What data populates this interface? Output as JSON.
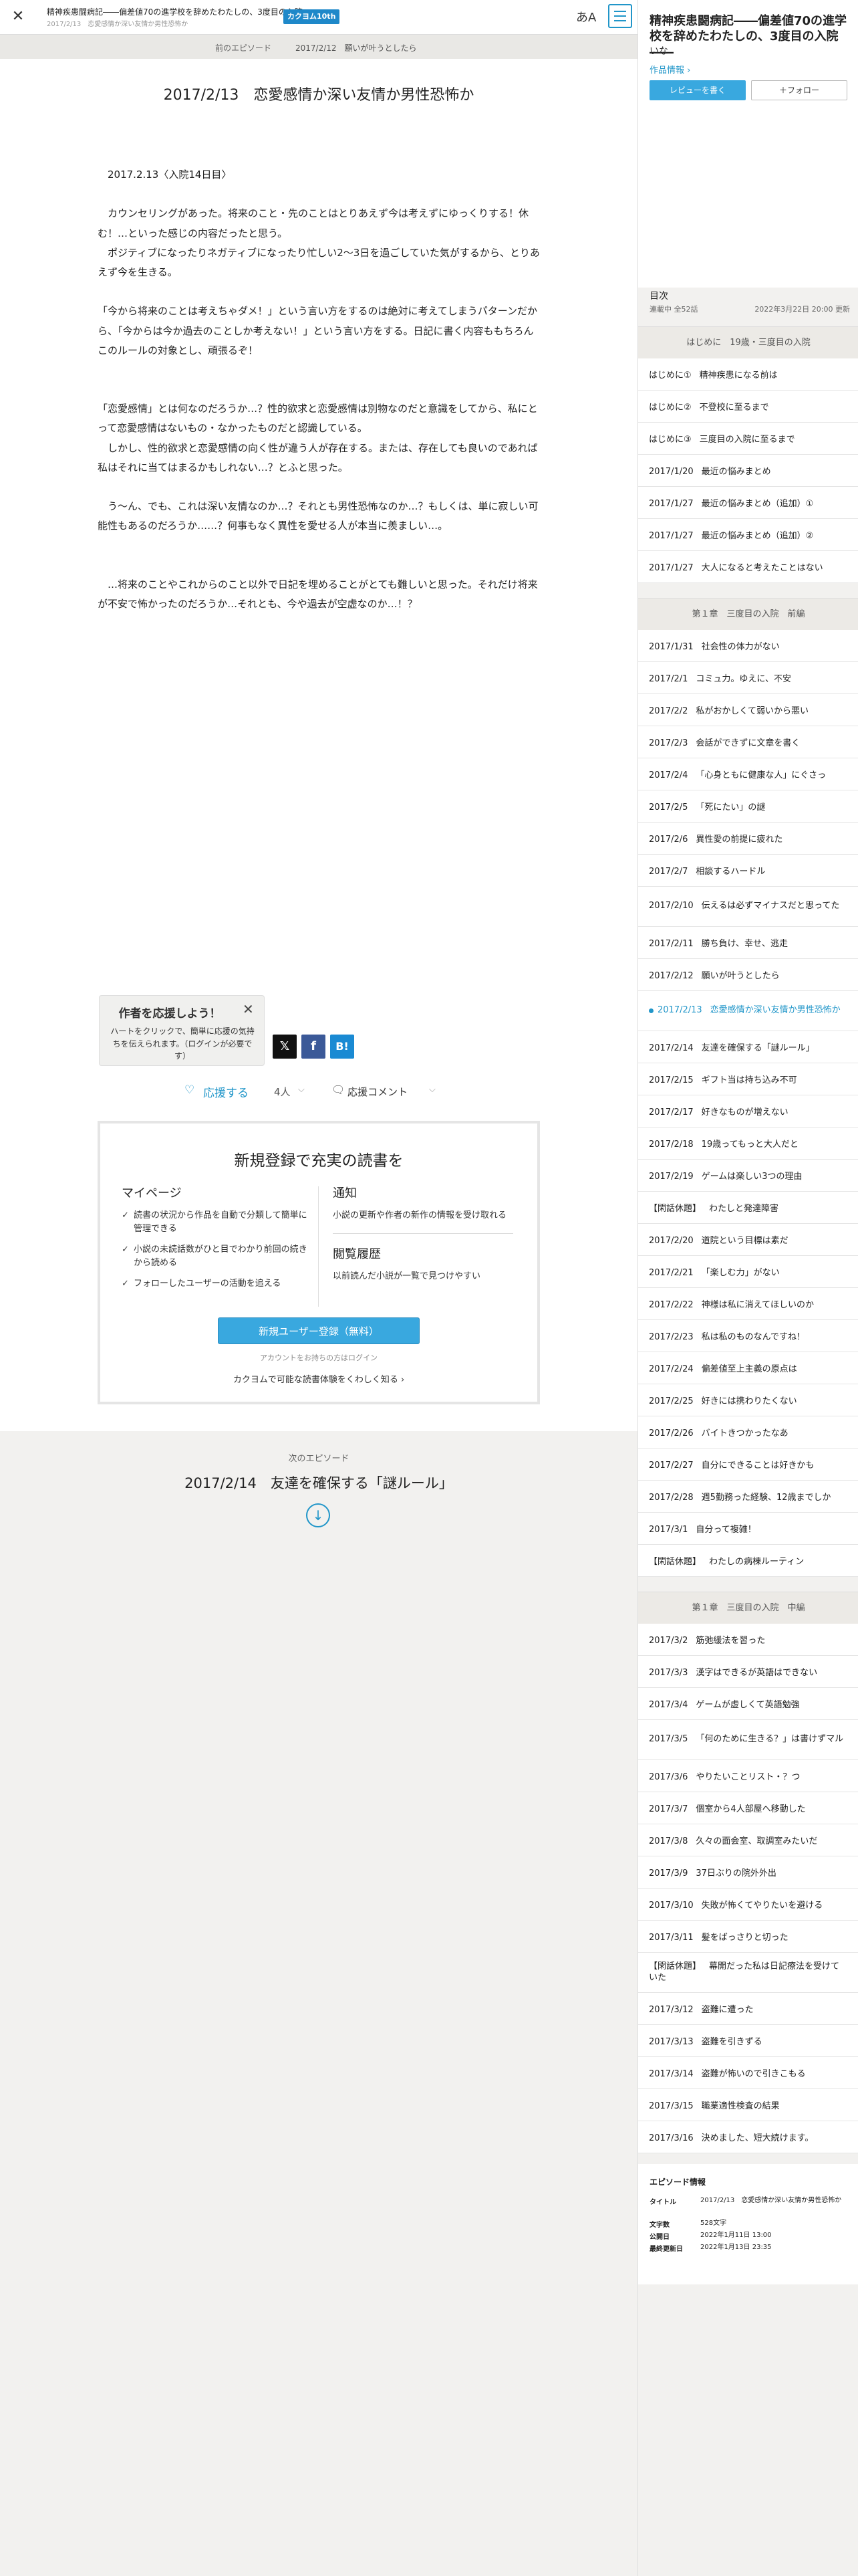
{
  "header": {
    "work_title": "精神疾患闘病記――偏差値70の進学校を辞めたわたしの、3度目の入院――",
    "episode_subtitle": "2017/2/13　恋愛感情か深い友情か男性恐怖か",
    "logo_text": "カクヨム10th",
    "font_toggle": "あA"
  },
  "episode_nav": {
    "prev_label": "前のエピソード",
    "prev_title": "2017/2/12　願いが叶うとしたら"
  },
  "episode": {
    "title": "2017/2/13　恋愛感情か深い友情か男性恐怖か",
    "paragraphs": [
      "",
      "　2017.2.13〈入院14日目〉",
      "",
      "　カウンセリングがあった。将来のこと・先のことはとりあえず今は考えずにゆっくりする！休む！…といった感じの内容だったと思う。",
      "　ポジティブになったりネガティブになったり忙しい2〜3日を過ごしていた気がするから、とりあえず今を生きる。",
      "",
      "「今から将来のことは考えちゃダメ！」という言い方をするのは絶対に考えてしまうパターンだから、「今からは今か過去のことしか考えない！」という言い方をする。日記に書く内容ももちろんこのルールの対象とし、頑張るぞ！",
      "",
      "",
      "「恋愛感情」とは何なのだろうか…？性的欲求と恋愛感情は別物なのだと意識をしてから、私にとって恋愛感情はないもの・なかったものだと認識している。",
      "　しかし、性的欲求と恋愛感情の向く性が違う人が存在する。または、存在しても良いのであれば私はそれに当てはまるかもしれない…？とふと思った。",
      "",
      "　う〜ん、でも、これは深い友情なのか…？それとも男性恐怖なのか…？もしくは、単に寂しい可能性もあるのだろうか……？何事もなく異性を愛せる人が本当に羨ましい…。",
      "",
      "",
      "　…将来のことやこれからのこと以外で日記を埋めることがとても難しいと思った。それだけ将来が不安で怖かったのだろうか…それとも、今や過去が空虚なのか…！？"
    ]
  },
  "support_popup": {
    "title": "作者を応援しよう！",
    "desc": "ハートをクリックで、簡単に応援の気持ちを伝えられます。（ログインが必要です）"
  },
  "share": {
    "x": "𝕏",
    "facebook": "f",
    "hatena": "B!"
  },
  "reactions": {
    "support_label": "応援する",
    "support_count": "4人",
    "comment_label": "応援コメント"
  },
  "register": {
    "title": "新規登録で充実の読書を",
    "mypage_title": "マイページ",
    "mypage_items": [
      "読書の状況から作品を自動で分類して簡単に管理できる",
      "小説の未読話数がひと目でわかり前回の続きから読める",
      "フォローしたユーザーの活動を追える"
    ],
    "notify_title": "通知",
    "notify_desc": "小説の更新や作者の新作の情報を受け取れる",
    "history_title": "閲覧履歴",
    "history_desc": "以前読んだ小説が一覧で見つけやすい",
    "button": "新規ユーザー登録（無料）",
    "login": "アカウントをお持ちの方はログイン",
    "more": "カクヨムで可能な読書体験をくわしく知る"
  },
  "next_episode": {
    "label": "次のエピソード",
    "title": "2017/2/14　友達を確保する「謎ルール」"
  },
  "sidebar": {
    "work_title": "精神疾患闘病記――偏差値70の進学校を辞めたわたしの、3度目の入院――",
    "author": "いな",
    "info_link": "作品情報",
    "review_button": "レビューを書く",
    "follow_button": "＋フォロー",
    "toc_heading": "目次",
    "toc_status": "連載中 全52話",
    "toc_updated": "2022年3月22日 20:00 更新",
    "chapters": [
      {
        "name": "はじめに　19歳・三度目の入院",
        "items": [
          {
            "d": "はじめに①",
            "t": "精神疾患になる前は"
          },
          {
            "d": "はじめに②",
            "t": "不登校に至るまで"
          },
          {
            "d": "はじめに③",
            "t": "三度目の入院に至るまで"
          },
          {
            "d": "2017/1/20",
            "t": "最近の悩みまとめ"
          },
          {
            "d": "2017/1/27",
            "t": "最近の悩みまとめ（追加）①"
          },
          {
            "d": "2017/1/27",
            "t": "最近の悩みまとめ（追加）②"
          },
          {
            "d": "2017/1/27",
            "t": "大人になると考えたことはない"
          }
        ]
      },
      {
        "name": "第１章　三度目の入院　前編",
        "items": [
          {
            "d": "2017/1/31",
            "t": "社会性の体力がない"
          },
          {
            "d": "2017/2/1",
            "t": "コミュ力。ゆえに、不安"
          },
          {
            "d": "2017/2/2",
            "t": "私がおかしくて弱いから悪い"
          },
          {
            "d": "2017/2/3",
            "t": "会話ができずに文章を書く"
          },
          {
            "d": "2017/2/4",
            "t": "「心身ともに健康な人」にぐさっ"
          },
          {
            "d": "2017/2/5",
            "t": "「死にたい」の謎"
          },
          {
            "d": "2017/2/6",
            "t": "異性愛の前提に疲れた"
          },
          {
            "d": "2017/2/7",
            "t": "相談するハードル"
          },
          {
            "d": "2017/2/10",
            "t": "伝えるは必ずマイナスだと思ってた",
            "tall": true
          },
          {
            "d": "2017/2/11",
            "t": "勝ち負け、幸せ、逃走"
          },
          {
            "d": "2017/2/12",
            "t": "願いが叶うとしたら"
          },
          {
            "d": "2017/2/13",
            "t": "恋愛感情か深い友情か男性恐怖か",
            "cur": true,
            "tall": true
          },
          {
            "d": "2017/2/14",
            "t": "友達を確保する「謎ルール」"
          },
          {
            "d": "2017/2/15",
            "t": "ギフト当は持ち込み不可"
          },
          {
            "d": "2017/2/17",
            "t": "好きなものが増えない"
          },
          {
            "d": "2017/2/18",
            "t": "19歳ってもっと大人だと"
          },
          {
            "d": "2017/2/19",
            "t": "ゲームは楽しい3つの理由"
          },
          {
            "d": "【閑話休題】",
            "t": "わたしと発達障害"
          },
          {
            "d": "2017/2/20",
            "t": "道院という目標は素だ"
          },
          {
            "d": "2017/2/21",
            "t": "「楽しむ力」がない"
          },
          {
            "d": "2017/2/22",
            "t": "神様は私に消えてほしいのか"
          },
          {
            "d": "2017/2/23",
            "t": "私は私のものなんですね！"
          },
          {
            "d": "2017/2/24",
            "t": "偏差値至上主義の原点は"
          },
          {
            "d": "2017/2/25",
            "t": "好きには携わりたくない"
          },
          {
            "d": "2017/2/26",
            "t": "バイトきつかったなあ"
          },
          {
            "d": "2017/2/27",
            "t": "自分にできることは好きかも"
          },
          {
            "d": "2017/2/28",
            "t": "週5勤務った経験、12歳までしか"
          },
          {
            "d": "2017/3/1",
            "t": "自分って複雑！"
          },
          {
            "d": "【閑話休題】",
            "t": "わたしの病棟ルーティン"
          }
        ]
      },
      {
        "name": "第１章　三度目の入院　中編",
        "items": [
          {
            "d": "2017/3/2",
            "t": "筋弛緩法を習った"
          },
          {
            "d": "2017/3/3",
            "t": "漢字はできるが英語はできない"
          },
          {
            "d": "2017/3/4",
            "t": "ゲームが虚しくて英語勉強"
          },
          {
            "d": "2017/3/5",
            "t": "「何のために生きる？」は書けずマル",
            "tall": true
          },
          {
            "d": "2017/3/6",
            "t": "やりたいことリスト・？つ"
          },
          {
            "d": "2017/3/7",
            "t": "個室から4人部屋へ移動した"
          },
          {
            "d": "2017/3/8",
            "t": "久々の面会室、取調室みたいだ"
          },
          {
            "d": "2017/3/9",
            "t": "37日ぶりの院外外出"
          },
          {
            "d": "2017/3/10",
            "t": "失敗が怖くてやりたいを避ける"
          },
          {
            "d": "2017/3/11",
            "t": "髪をばっさりと切った"
          },
          {
            "d": "【閑話休題】",
            "t": "幕開だった私は日記療法を受けていた",
            "tall": true
          },
          {
            "d": "2017/3/12",
            "t": "盗難に遭った"
          },
          {
            "d": "2017/3/13",
            "t": "盗難を引きずる"
          },
          {
            "d": "2017/3/14",
            "t": "盗難が怖いので引きこもる"
          },
          {
            "d": "2017/3/15",
            "t": "職業適性検査の結果"
          },
          {
            "d": "2017/3/16",
            "t": "決めました、短大続けます。"
          }
        ]
      }
    ],
    "ep_info": {
      "heading": "エピソード情報",
      "title_key": "タイトル",
      "title_val": "2017/2/13　恋愛感情か深い友情か男性恐怖か",
      "chars_key": "文字数",
      "chars_val": "528文字",
      "pub_key": "公開日",
      "pub_val": "2022年1月11日 13:00",
      "upd_key": "最終更新日",
      "upd_val": "2022年1月13日 23:35"
    }
  }
}
